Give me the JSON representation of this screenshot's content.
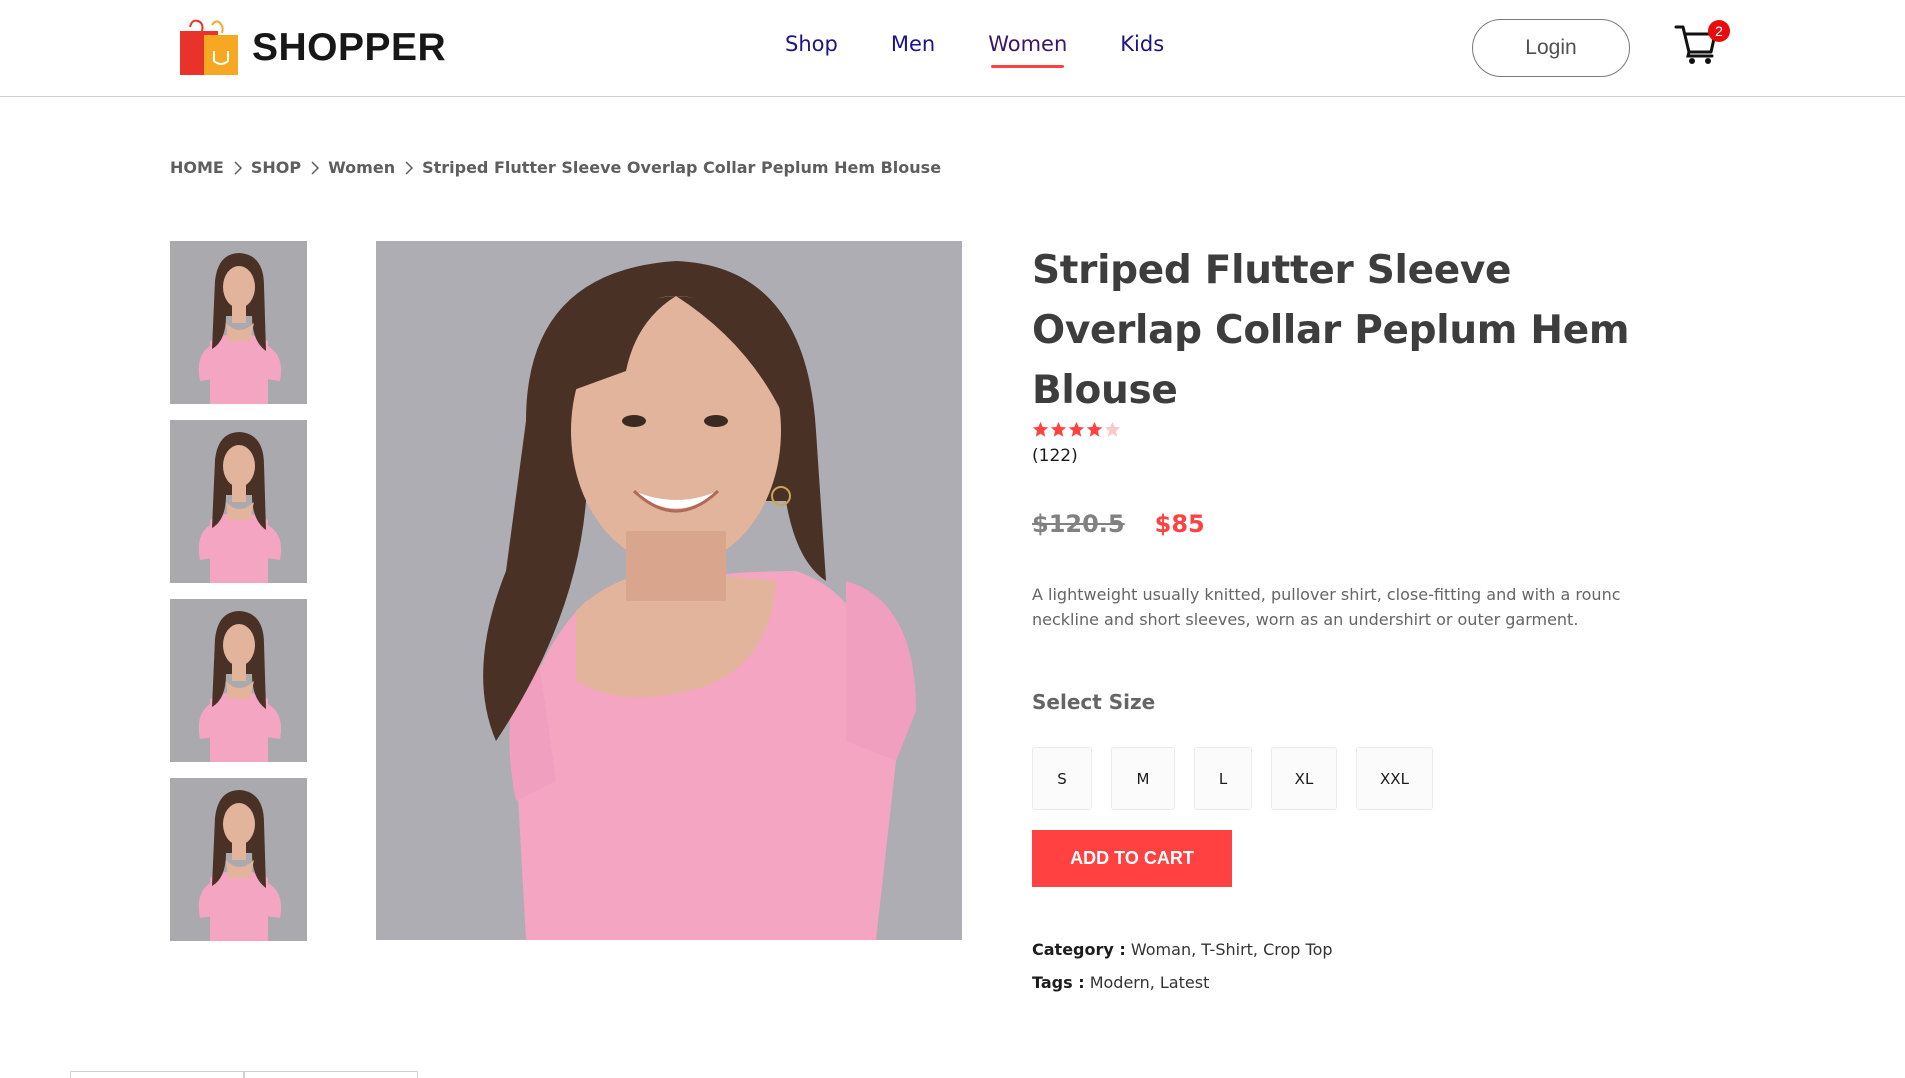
{
  "brand": {
    "name": "SHOPPER",
    "logo_icon": "shopping-bag-icon",
    "logo_colors": [
      "#e8322a",
      "#f6a823"
    ]
  },
  "nav": {
    "items": [
      {
        "label": "Shop"
      },
      {
        "label": "Men"
      },
      {
        "label": "Women",
        "active": true
      },
      {
        "label": "Kids"
      }
    ],
    "accent": "#ff4141"
  },
  "header": {
    "login_label": "Login",
    "cart_count": "2",
    "cart_icon": "cart-icon"
  },
  "breadcrumb": [
    "HOME",
    "SHOP",
    "Women",
    "Striped Flutter Sleeve Overlap Collar Peplum Hem Blouse"
  ],
  "product": {
    "title": "Striped Flutter Sleeve Overlap Collar Peplum Hem Blouse",
    "rating": 4,
    "rating_max": 5,
    "reviews": "(122)",
    "price_old": "$120.5",
    "price_new": "$85",
    "description": "A lightweight usually knitted, pullover shirt, close-fitting and with a rounc neckline and short sleeves, worn as an undershirt or outer garment.",
    "size_title": "Select Size",
    "sizes": [
      "S",
      "M",
      "L",
      "XL",
      "XXL"
    ],
    "add_to_cart": "ADD TO CART",
    "category_label": "Category :",
    "category_value": "Woman, T-Shirt, Crop Top",
    "tags_label": "Tags :",
    "tags_value": "Modern, Latest",
    "image_colors": {
      "background": "#a9a9ae",
      "shirt": "#f3a5c2",
      "hair": "#4a3126",
      "skin": "#e3b49c"
    }
  }
}
